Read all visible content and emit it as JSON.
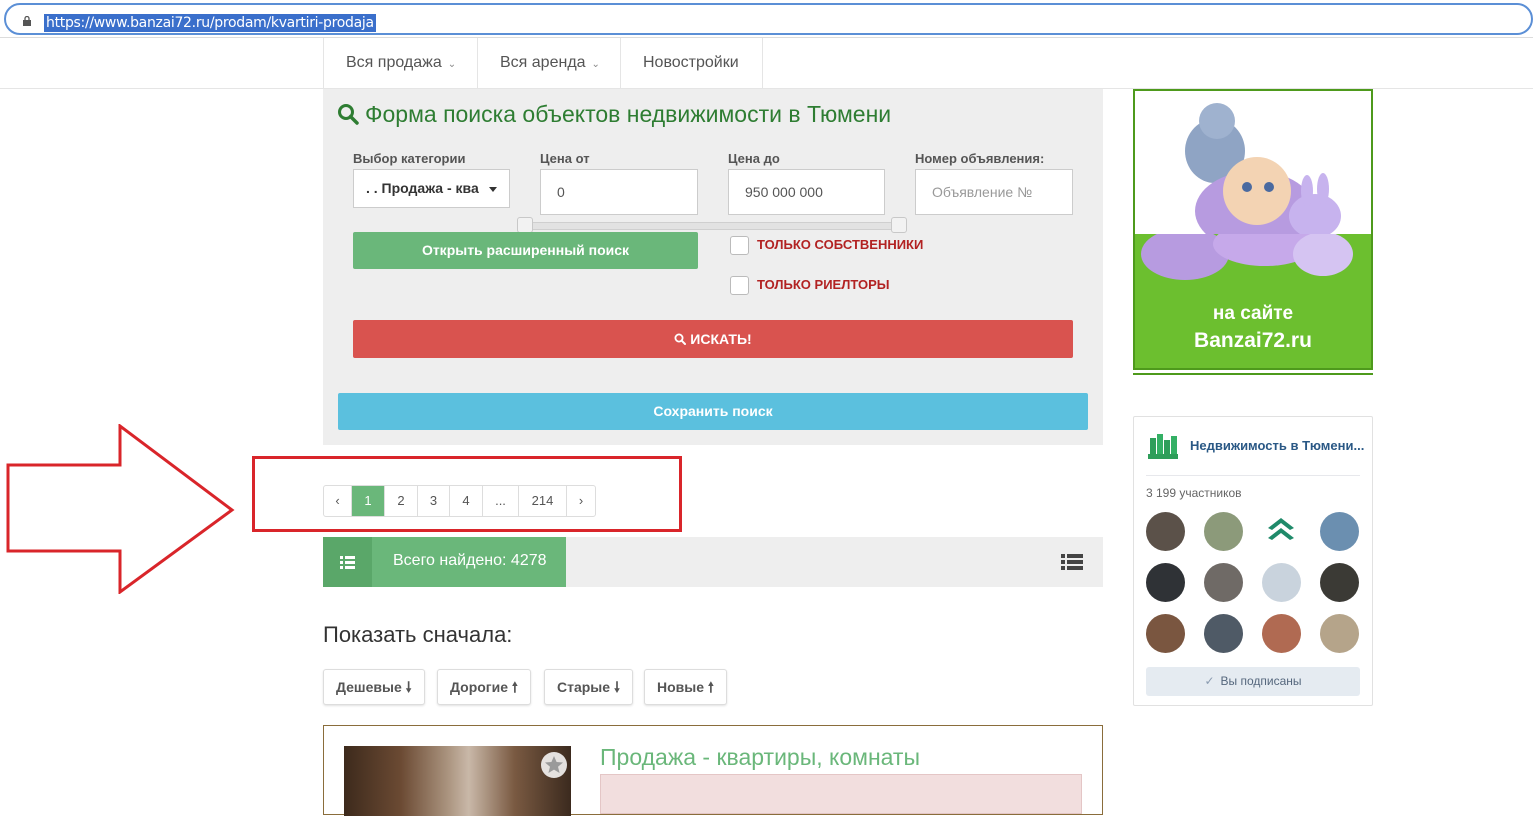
{
  "browser": {
    "url": "https://www.banzai72.ru/prodam/kvartiri-prodaja"
  },
  "nav": {
    "items": [
      {
        "label": "Вся продажа",
        "dropdown": true
      },
      {
        "label": "Вся аренда",
        "dropdown": true
      },
      {
        "label": "Новостройки",
        "dropdown": false
      }
    ]
  },
  "search": {
    "title": "Форма поиска объектов недвижимости в Тюмени",
    "category_label": "Выбор категории",
    "category_value": ". . Продажа - ква",
    "price_from_label": "Цена от",
    "price_from_value": "0",
    "price_to_label": "Цена до",
    "price_to_value": "950 000 000",
    "ad_number_label": "Номер объявления:",
    "ad_number_placeholder": "Объявление №",
    "advanced_button": "Открыть расширенный поиск",
    "owners_only": "ТОЛЬКО СОБСТВЕННИКИ",
    "realtors_only": "ТОЛЬКО РИЕЛТОРЫ",
    "search_button": "ИСКАТЬ!",
    "save_button": "Сохранить поиск"
  },
  "pagination": {
    "prev": "‹",
    "pages": [
      "1",
      "2",
      "3",
      "4",
      "...",
      "214"
    ],
    "active": "1",
    "next": "›"
  },
  "results": {
    "found_text": "Всего найдено: 4278"
  },
  "sort": {
    "heading": "Показать сначала:",
    "buttons": [
      {
        "label": "Дешевые",
        "arrow": "down"
      },
      {
        "label": "Дорогие",
        "arrow": "up"
      },
      {
        "label": "Старые",
        "arrow": "down"
      },
      {
        "label": "Новые",
        "arrow": "up"
      }
    ]
  },
  "listing": {
    "title": "Продажа - квартиры, комнаты"
  },
  "ad_banner": {
    "line1": "на сайте",
    "line2": "Banzai72.ru"
  },
  "vk_widget": {
    "group_name": "Недвижимость в Тюмени...",
    "members": "3 199 участников",
    "subscribed": "Вы подписаны",
    "avatar_colors": [
      "#5b5149",
      "#8c9a7a",
      "#ffffff",
      "#6b8fb0",
      "#2f3236",
      "#6f6a66",
      "#c9d3dd",
      "#3b3a35",
      "#7a5640",
      "#4f5a66",
      "#b06a52",
      "#b5a48a"
    ]
  },
  "colors": {
    "green": "#6ab77a",
    "red": "#d9534f",
    "blue": "#5bc0de",
    "annotation": "#d9252a"
  }
}
